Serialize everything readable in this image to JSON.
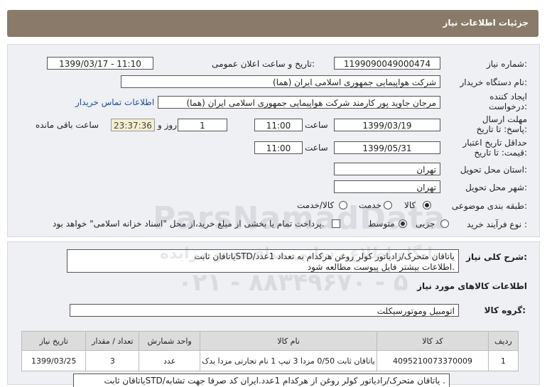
{
  "header": {
    "title": "جزئیات اطلاعات نیاز"
  },
  "form": {
    "need_number_label": "شماره نیاز:",
    "need_number": "1199090049000474",
    "announce_label": "تاریخ و ساعت اعلان عمومی:",
    "announce_value": "1399/03/17 - 11:10",
    "buyer_label": "نام دستگاه خریدار:",
    "buyer_value": "شرکت هواپیمایی جمهوری اسلامی ایران (هما)",
    "creator_label": "ایجاد کننده درخواست:",
    "creator_value": "مرجان جاوید پور کارمند شرکت هواپیمایی جمهوری اسلامی ایران (هما)",
    "contact_link": "اطلاعات تماس خریدار",
    "deadline_label": "مهلت ارسال پاسخ: تا تاریخ:",
    "deadline_date": "1399/03/19",
    "time_label": "ساعت",
    "deadline_time": "11:00",
    "days_value": "1",
    "days_label": "روز و",
    "remaining_timer": "23:37:36",
    "remaining_label": "ساعت باقی مانده",
    "validity_label": "حداقل تاریخ اعتبار قیمت: تا تاریخ:",
    "validity_date": "1399/05/31",
    "validity_time": "11:00",
    "province_label": "استان محل تحویل:",
    "province_value": "تهران",
    "city_label": "شهر محل تحویل:",
    "city_value": "تهران",
    "category_label": "طبقه بندی موضوعی:",
    "category_options": [
      "کالا",
      "خدمت",
      "کالا/خدمت"
    ],
    "category_selected": "کالا",
    "process_label": "نوع فرآیند خرید :",
    "process_options": [
      "جزیی",
      "متوسط"
    ],
    "process_selected": "متوسط",
    "payment_note": "پرداخت تمام یا بخشی از مبلغ خرید،از محل \"اسناد خزانه اسلامی\" خواهد بود."
  },
  "details": {
    "summary_label": "شرح کلی نیاز:",
    "summary_line1": "یاتاقان ثابتSTD/یاتاقان متحرک/رادیاتور کولر روغن  هرکدام به تعداد 1عدد",
    "summary_line2": "اطلاعات بیشتر فایل پیوست مطالعه شود.",
    "goods_info_title": "اطلاعات کالاهای مورد نیاز",
    "goods_group_label": "گروه کالا:",
    "goods_group_value": "اتومبیل وموتورسیکلت",
    "table_headers": [
      "ردیف",
      "کد کالا",
      "نام کالا",
      "واحد شمارش",
      "تعداد / مقدار",
      "تاریخ نیاز"
    ],
    "rows": [
      [
        "1",
        "4095210073370009",
        "یاتاقان ثابت 0/50 مزدا 3 تیپ 1 نام تجارتی مزدا یدک",
        "عدد",
        "3",
        "1399/03/25"
      ]
    ],
    "bottom_note": "یاتاقان ثابتSTD/یاتاقان متحرک/رادیاتور کولر روغن از هرکدام 1عدد.ایران کد صرفا جهت تشابه ."
  },
  "watermark": {
    "brand": "ParsNamadData",
    "line1": "پایگاه اطلاع رسانی مناقصه و مزایده",
    "phone": "۰۲۱ - ۸۸۳۴۹۶۷۰ - ۵"
  }
}
